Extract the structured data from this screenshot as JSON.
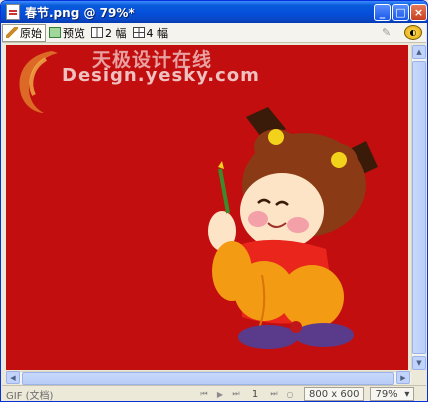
{
  "window": {
    "title": "春节.png @ 79%*",
    "controls": {
      "minimize": "_",
      "maximize": "□",
      "close": "×"
    }
  },
  "toolbar": {
    "tabs": [
      {
        "label": "原始",
        "icon": "pencil-icon",
        "active": true
      },
      {
        "label": "预览",
        "icon": "preview-icon",
        "active": false
      },
      {
        "label": "2 幅",
        "icon": "two-up-icon",
        "active": false
      },
      {
        "label": "4 幅",
        "icon": "four-up-icon",
        "active": false
      }
    ],
    "right_icons": [
      "quality-icon",
      "export-options-icon"
    ]
  },
  "canvas": {
    "background": "#c20e0e",
    "watermark_cn": "天极设计在线",
    "watermark_en": "Design.yesky.com"
  },
  "statusbar": {
    "left_text": "GIF (文档)",
    "page": "1",
    "dimensions": "800 x 600",
    "zoom": "79%"
  }
}
